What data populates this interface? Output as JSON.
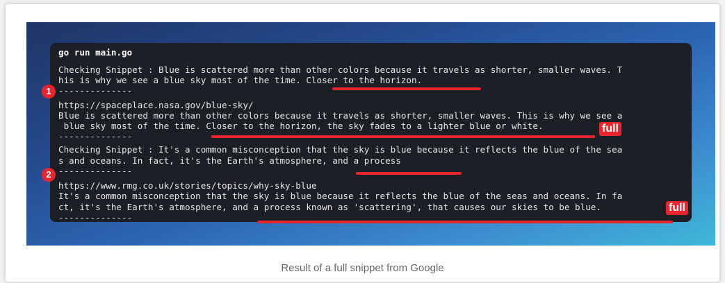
{
  "terminal": {
    "command": "go run main.go",
    "lines": [
      "Checking Snippet : Blue is scattered more than other colors because it travels as shorter, smaller waves. T",
      "his is why we see a blue sky most of the time. Closer to the horizon.",
      "--------------",
      "https://spaceplace.nasa.gov/blue-sky/",
      "Blue is scattered more than other colors because it travels as shorter, smaller waves. This is why we see a",
      " blue sky most of the time. Closer to the horizon, the sky fades to a lighter blue or white.",
      "--------------",
      "Checking Snippet : It's a common misconception that the sky is blue because it reflects the blue of the sea",
      "s and oceans. In fact, it's the Earth's atmosphere, and a process",
      "--------------",
      "https://www.rmg.co.uk/stories/topics/why-sky-blue",
      "It's a common misconception that the sky is blue because it reflects the blue of the seas and oceans. In fa",
      "ct, it's the Earth's atmosphere, and a process known as 'scattering', that causes our skies to be blue.",
      "--------------"
    ]
  },
  "annotations": {
    "marker_1": "1",
    "marker_2": "2",
    "badge_1": "full",
    "badge_2": "full"
  },
  "caption": "Result of a full snippet from Google",
  "colors": {
    "accent": "#e8252f",
    "terminal_bg": "#1c1f26"
  }
}
